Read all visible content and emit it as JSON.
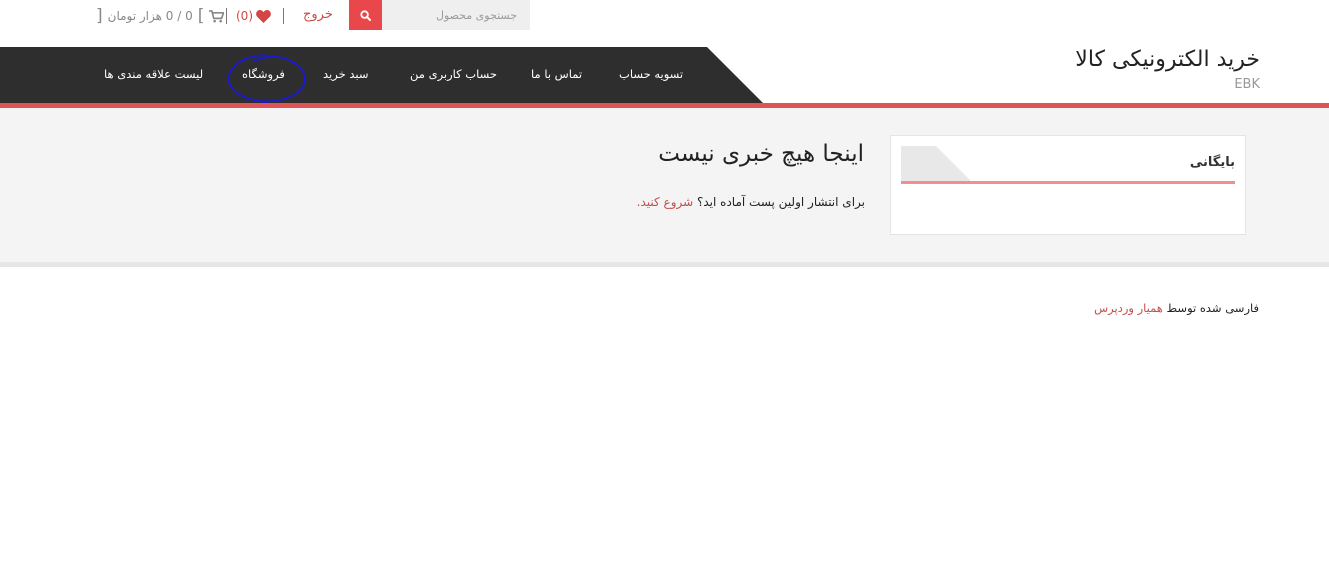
{
  "topbar": {
    "search_placeholder": "جستجوی محصول",
    "logout_label": "خروج",
    "wishlist_count": "(0)",
    "cart_summary": "0 / 0 هزار تومان",
    "bracket_open": "[",
    "bracket_close": "]"
  },
  "header": {
    "site_title": "خرید الکترونیکی کالا",
    "site_subtitle": "EBK"
  },
  "nav": {
    "items": [
      {
        "label": "تسویه حساب"
      },
      {
        "label": "تماس با ما"
      },
      {
        "label": "حساب کاربری من"
      },
      {
        "label": "سبد خرید"
      },
      {
        "label": "فروشگاه"
      },
      {
        "label": "لیست علاقه مندی ها"
      }
    ]
  },
  "sidebar": {
    "widget_title": "بایگانی"
  },
  "main": {
    "empty_title": "اینجا هیچ خبری نیست",
    "empty_text": "برای انتشار اولین پست آماده اید؟",
    "start_link": "شروع کنید."
  },
  "footer": {
    "credit_text": "فارسی شده توسط",
    "credit_link": "همیار وردپرس"
  },
  "colors": {
    "accent": "#e15254",
    "navbar": "#2e2e2e",
    "link": "#c0504d",
    "annotation": "#1a1ad6"
  },
  "icons": [
    "search-icon",
    "heart-icon",
    "cart-icon"
  ]
}
